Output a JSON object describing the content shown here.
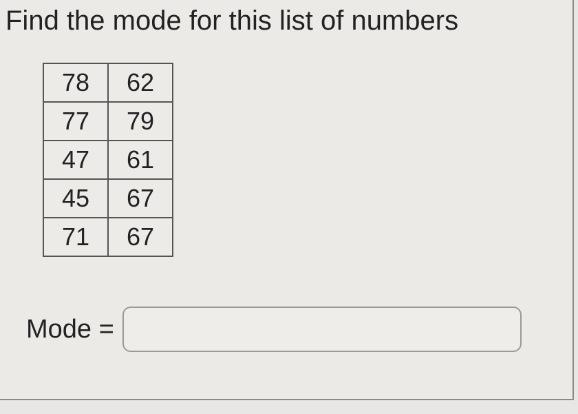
{
  "prompt": "Find the mode for this list of numbers",
  "table": {
    "rows": [
      {
        "c1": "78",
        "c2": "62"
      },
      {
        "c1": "77",
        "c2": "79"
      },
      {
        "c1": "47",
        "c2": "61"
      },
      {
        "c1": "45",
        "c2": "67"
      },
      {
        "c1": "71",
        "c2": "67"
      }
    ]
  },
  "answer": {
    "label": "Mode =",
    "value": "",
    "placeholder": ""
  }
}
